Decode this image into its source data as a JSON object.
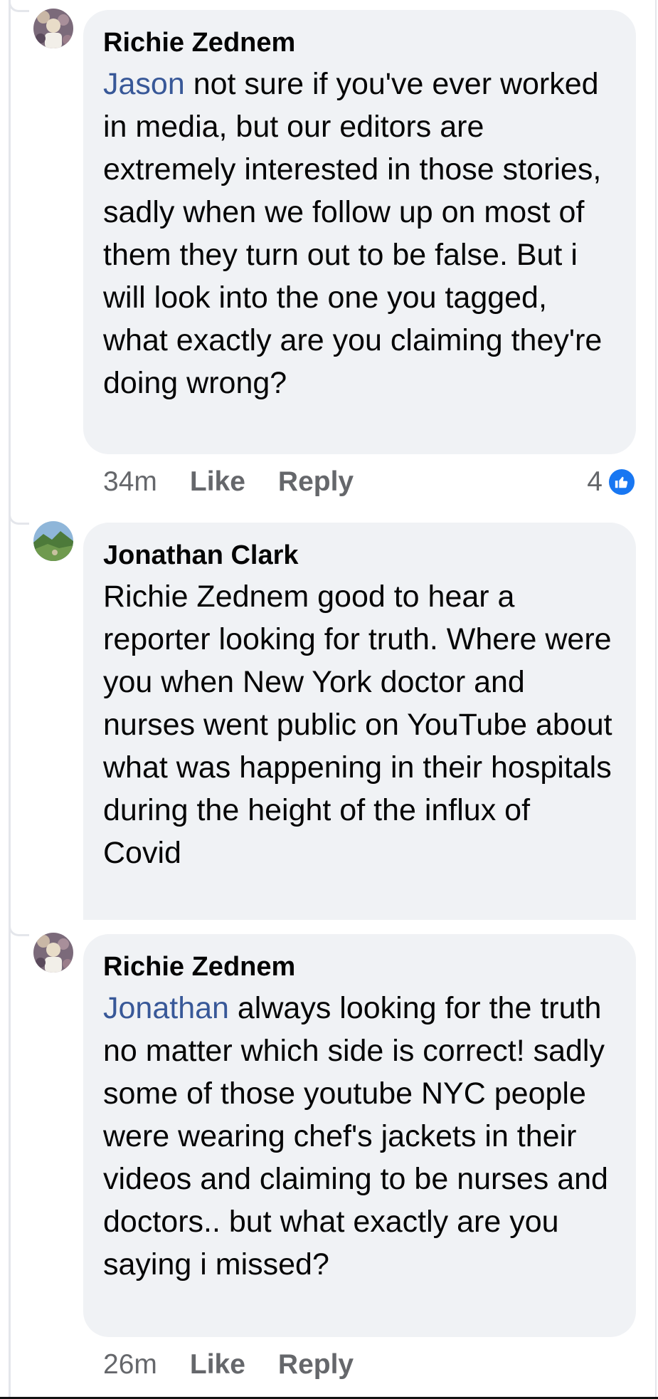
{
  "comments": [
    {
      "author": "Richie Zednem",
      "mention": "Jason",
      "text": " not sure if you've ever worked in media, but our editors are extremely interested in those stories, sadly when we follow up on most of them they turn out to be false. But i will look into the one you tagged, what exactly are you claiming they're doing wrong?",
      "time": "34m",
      "like_label": "Like",
      "reply_label": "Reply",
      "reaction_count": "4",
      "avatar_icon": "user-avatar-icon"
    },
    {
      "author": "Jonathan Clark",
      "text": "Richie Zednem good to hear a reporter looking for truth. Where were you when New York doctor and nurses went public on YouTube about what was happening in their hospitals during the height of the influx of Covid",
      "avatar_icon": "landscape-avatar-icon"
    },
    {
      "author": "Richie Zednem",
      "mention": "Jonathan",
      "text": " always looking for the truth no matter which side is correct! sadly some of those youtube NYC people were wearing chef's jackets in their videos and claiming to be nurses and doctors.. but what exactly are you saying i missed?",
      "time": "26m",
      "like_label": "Like",
      "reply_label": "Reply",
      "avatar_icon": "user-avatar-icon"
    }
  ],
  "colors": {
    "bubble": "#f0f2f5",
    "mention": "#385898",
    "meta": "#65676b",
    "like_blue": "#1877f2"
  }
}
